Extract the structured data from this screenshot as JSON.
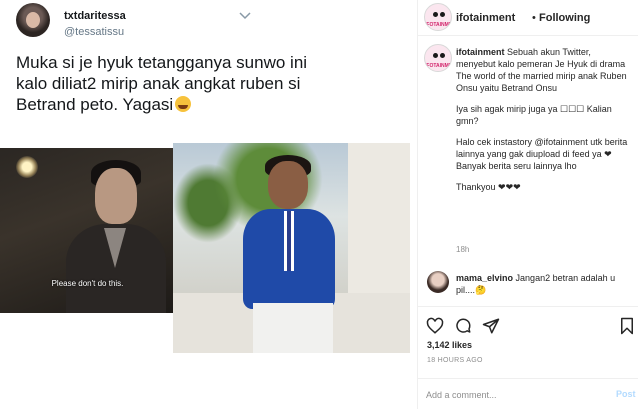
{
  "tweet": {
    "name": "txtdaritessa",
    "handle": "@tessatissu",
    "text": "Muka si je hyuk tetangganya sunwo ini kalo diliat2 mirip anak angkat ruben si Betrand peto. Yagasi",
    "emoji_icon": "rofl-emoji",
    "subtitle": "Please don't do this."
  },
  "post": {
    "username": "ifotainment",
    "separator": "•",
    "follow_status": "Following",
    "avatar_text": "iFOTAINMENT",
    "caption_paragraphs": [
      "Sebuah akun Twitter, menyebut kalo pemeran Je Hyuk di drama The world of the married mirip anak Ruben Onsu yaitu Betrand Onsu",
      "Iya sih agak mirip juga ya ☐☐☐ Kalian gmn?",
      "Halo cek instastory @ifotainment utk berita lainnya yang gak diupload di feed ya ❤ Banyak berita seru lainnya lho",
      "Thankyou ❤❤❤"
    ],
    "caption_time": "18h",
    "comment": {
      "username": "mama_elvino",
      "text": "Jangan2 betran adalah u pil....🤔"
    },
    "likes": "3,142 likes",
    "time_ago": "18 HOURS AGO",
    "add_comment_placeholder": "Add a comment...",
    "post_button": "Post"
  },
  "colors": {
    "link": "#00376b",
    "post_button": "#b3dbff",
    "muted": "#8e8e8e",
    "brand_pink": "#d2246b"
  },
  "icons": [
    "heart-icon",
    "comment-icon",
    "share-icon",
    "bookmark-icon",
    "caret-down-icon"
  ]
}
